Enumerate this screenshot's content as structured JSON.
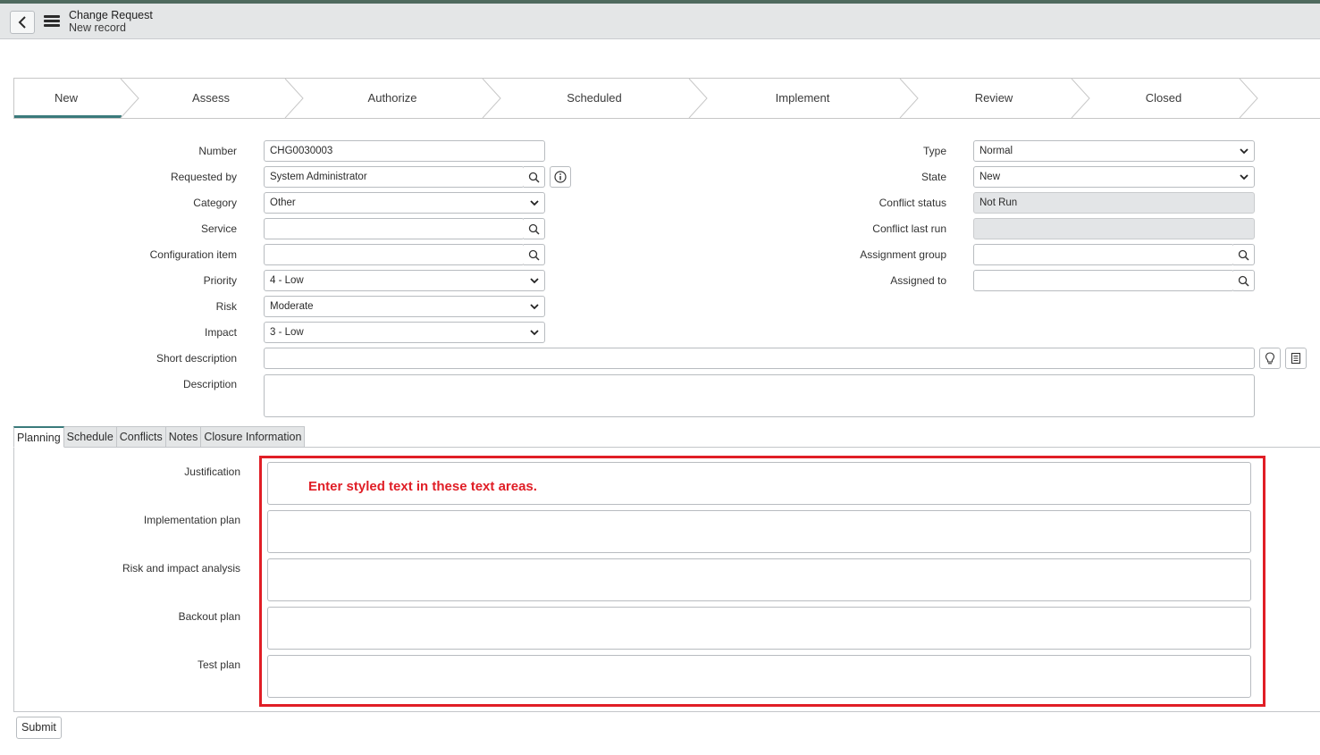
{
  "header": {
    "title": "Change Request",
    "subtitle": "New record",
    "back_icon": "chevron-left-icon",
    "menu_icon": "hamburger-menu-icon"
  },
  "stages": [
    "New",
    "Assess",
    "Authorize",
    "Scheduled",
    "Implement",
    "Review",
    "Closed"
  ],
  "form_left": {
    "number": {
      "label": "Number",
      "value": "CHG0030003"
    },
    "requested_by": {
      "label": "Requested by",
      "value": "System Administrator"
    },
    "category": {
      "label": "Category",
      "value": "Other"
    },
    "service": {
      "label": "Service",
      "value": ""
    },
    "configuration_item": {
      "label": "Configuration item",
      "value": ""
    },
    "priority": {
      "label": "Priority",
      "value": "4 - Low"
    },
    "risk": {
      "label": "Risk",
      "value": "Moderate"
    },
    "impact": {
      "label": "Impact",
      "value": "3 - Low"
    },
    "short_description": {
      "label": "Short description",
      "value": ""
    },
    "description": {
      "label": "Description",
      "value": ""
    }
  },
  "form_right": {
    "type": {
      "label": "Type",
      "value": "Normal"
    },
    "state": {
      "label": "State",
      "value": "New"
    },
    "conflict_status": {
      "label": "Conflict status",
      "value": "Not Run"
    },
    "conflict_last_run": {
      "label": "Conflict last run",
      "value": ""
    },
    "assignment_group": {
      "label": "Assignment group",
      "value": ""
    },
    "assigned_to": {
      "label": "Assigned to",
      "value": ""
    }
  },
  "tabs": [
    "Planning",
    "Schedule",
    "Conflicts",
    "Notes",
    "Closure Information"
  ],
  "planning": {
    "justification": "Justification",
    "implementation_plan": "Implementation plan",
    "risk_and_impact": "Risk and impact analysis",
    "backout_plan": "Backout plan",
    "test_plan": "Test plan"
  },
  "annotation": {
    "text": "Enter styled text in these text areas.",
    "color": "#e01e26"
  },
  "submit_label": "Submit",
  "colors": {
    "accent": "#3a7a7b",
    "header_bg": "#e4e6e7"
  }
}
